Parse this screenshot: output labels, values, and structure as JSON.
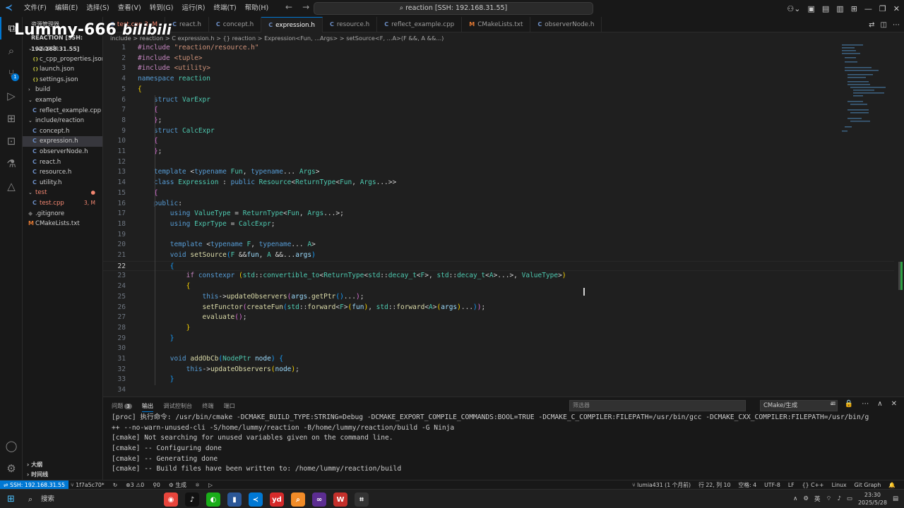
{
  "menu": [
    "文件(F)",
    "编辑(E)",
    "选择(S)",
    "查看(V)",
    "转到(G)",
    "运行(R)",
    "终端(T)",
    "帮助(H)"
  ],
  "command_center": "reaction [SSH: 192.168.31.55]",
  "watermark": {
    "name": "Lummy-666",
    "site": "bilibili"
  },
  "sidebar": {
    "title": "资源管理器",
    "root": "REACTION [SSH: 192.168.31.55]",
    "items": [
      {
        "label": ".vscode",
        "kind": "folder-open",
        "depth": 1
      },
      {
        "label": "c_cpp_properties.json",
        "kind": "json",
        "depth": 2
      },
      {
        "label": "launch.json",
        "kind": "json",
        "depth": 2
      },
      {
        "label": "settings.json",
        "kind": "json",
        "depth": 2
      },
      {
        "label": "build",
        "kind": "folder",
        "depth": 1
      },
      {
        "label": "example",
        "kind": "folder-open",
        "depth": 1
      },
      {
        "label": "reflect_example.cpp",
        "kind": "cpp",
        "depth": 2
      },
      {
        "label": "include/reaction",
        "kind": "folder-open",
        "depth": 1
      },
      {
        "label": "concept.h",
        "kind": "cpp",
        "depth": 2
      },
      {
        "label": "expression.h",
        "kind": "cpp",
        "depth": 2,
        "selected": true
      },
      {
        "label": "observerNode.h",
        "kind": "cpp",
        "depth": 2
      },
      {
        "label": "react.h",
        "kind": "cpp",
        "depth": 2
      },
      {
        "label": "resource.h",
        "kind": "cpp",
        "depth": 2
      },
      {
        "label": "utility.h",
        "kind": "cpp",
        "depth": 2
      },
      {
        "label": "test",
        "kind": "folder-open",
        "depth": 1,
        "error": true,
        "tag": "●"
      },
      {
        "label": "test.cpp",
        "kind": "cpp",
        "depth": 2,
        "error": true,
        "tag": "3, M"
      },
      {
        "label": ".gitignore",
        "kind": "git",
        "depth": 1
      },
      {
        "label": "CMakeLists.txt",
        "kind": "cmake",
        "depth": 1
      }
    ],
    "outline": "大纲",
    "timeline": "时间线"
  },
  "tabs": [
    {
      "label": "test.cpp 3, M",
      "err": true
    },
    {
      "label": "react.h"
    },
    {
      "label": "concept.h"
    },
    {
      "label": "expression.h",
      "active": true
    },
    {
      "label": "resource.h"
    },
    {
      "label": "reflect_example.cpp"
    },
    {
      "label": "CMakeLists.txt",
      "cmake": true
    },
    {
      "label": "observerNode.h"
    }
  ],
  "breadcrumb": "include > reaction > C expression.h > {} reaction > Expression<Fun, ...Args> > setSource<F, ...A>(F &&, A &&...)",
  "code": [
    {
      "n": 1,
      "t": [
        [
          "pp",
          "#include "
        ],
        [
          "str",
          "\"reaction/resource.h\""
        ]
      ]
    },
    {
      "n": 2,
      "t": [
        [
          "pp",
          "#include "
        ],
        [
          "str",
          "<tuple>"
        ]
      ]
    },
    {
      "n": 3,
      "t": [
        [
          "pp",
          "#include "
        ],
        [
          "str",
          "<utility>"
        ]
      ]
    },
    {
      "n": 4,
      "t": [
        [
          "kw",
          "namespace "
        ],
        [
          "ty",
          "reaction"
        ]
      ]
    },
    {
      "n": 5,
      "t": [
        [
          "br1",
          "{"
        ]
      ]
    },
    {
      "n": 6,
      "t": [
        [
          "op",
          "    "
        ],
        [
          "kw",
          "struct "
        ],
        [
          "ty",
          "VarExpr"
        ]
      ]
    },
    {
      "n": 7,
      "t": [
        [
          "op",
          "    "
        ],
        [
          "br2",
          "{"
        ]
      ]
    },
    {
      "n": 8,
      "t": [
        [
          "op",
          "    "
        ],
        [
          "br2",
          "}"
        ],
        [
          "op",
          ";"
        ]
      ]
    },
    {
      "n": 9,
      "t": [
        [
          "op",
          "    "
        ],
        [
          "kw",
          "struct "
        ],
        [
          "ty",
          "CalcExpr"
        ]
      ]
    },
    {
      "n": 10,
      "t": [
        [
          "op",
          "    "
        ],
        [
          "br2",
          "{"
        ]
      ]
    },
    {
      "n": 11,
      "t": [
        [
          "op",
          "    "
        ],
        [
          "br2",
          "}"
        ],
        [
          "op",
          ";"
        ]
      ]
    },
    {
      "n": 12,
      "t": []
    },
    {
      "n": 13,
      "t": [
        [
          "op",
          "    "
        ],
        [
          "kw",
          "template "
        ],
        [
          "op",
          "<"
        ],
        [
          "kw",
          "typename "
        ],
        [
          "ty",
          "Fun"
        ],
        [
          "op",
          ", "
        ],
        [
          "kw",
          "typename"
        ],
        [
          "op",
          "... "
        ],
        [
          "ty",
          "Args"
        ],
        [
          "op",
          ">"
        ]
      ]
    },
    {
      "n": 14,
      "t": [
        [
          "op",
          "    "
        ],
        [
          "kw",
          "class "
        ],
        [
          "ty",
          "Expression"
        ],
        [
          "op",
          " : "
        ],
        [
          "kw",
          "public "
        ],
        [
          "ty",
          "Resource"
        ],
        [
          "op",
          "<"
        ],
        [
          "ty",
          "ReturnType"
        ],
        [
          "op",
          "<"
        ],
        [
          "ty",
          "Fun"
        ],
        [
          "op",
          ", "
        ],
        [
          "ty",
          "Args"
        ],
        [
          "op",
          "...>>"
        ]
      ]
    },
    {
      "n": 15,
      "t": [
        [
          "op",
          "    "
        ],
        [
          "br2",
          "{"
        ]
      ]
    },
    {
      "n": 16,
      "t": [
        [
          "op",
          "    "
        ],
        [
          "kw",
          "public"
        ],
        [
          "op",
          ":"
        ]
      ]
    },
    {
      "n": 17,
      "t": [
        [
          "op",
          "        "
        ],
        [
          "kw",
          "using "
        ],
        [
          "ty",
          "ValueType"
        ],
        [
          "op",
          " = "
        ],
        [
          "ty",
          "ReturnType"
        ],
        [
          "op",
          "<"
        ],
        [
          "ty",
          "Fun"
        ],
        [
          "op",
          ", "
        ],
        [
          "ty",
          "Args"
        ],
        [
          "op",
          "...>;"
        ]
      ]
    },
    {
      "n": 18,
      "t": [
        [
          "op",
          "        "
        ],
        [
          "kw",
          "using "
        ],
        [
          "ty",
          "ExprType"
        ],
        [
          "op",
          " = "
        ],
        [
          "ty",
          "CalcExpr"
        ],
        [
          "op",
          ";"
        ]
      ]
    },
    {
      "n": 19,
      "t": []
    },
    {
      "n": 20,
      "t": [
        [
          "op",
          "        "
        ],
        [
          "kw",
          "template "
        ],
        [
          "op",
          "<"
        ],
        [
          "kw",
          "typename "
        ],
        [
          "ty",
          "F"
        ],
        [
          "op",
          ", "
        ],
        [
          "kw",
          "typename"
        ],
        [
          "op",
          "... "
        ],
        [
          "ty",
          "A"
        ],
        [
          "op",
          ">"
        ]
      ]
    },
    {
      "n": 21,
      "t": [
        [
          "op",
          "        "
        ],
        [
          "kw",
          "void "
        ],
        [
          "fn",
          "setSource"
        ],
        [
          "br3",
          "("
        ],
        [
          "ty",
          "F"
        ],
        [
          "op",
          " &&"
        ],
        [
          "id",
          "fun"
        ],
        [
          "op",
          ", "
        ],
        [
          "ty",
          "A"
        ],
        [
          "op",
          " &&..."
        ],
        [
          "id",
          "args"
        ],
        [
          "br3",
          ")"
        ]
      ]
    },
    {
      "n": 22,
      "t": [
        [
          "op",
          "        "
        ],
        [
          "br3",
          "{"
        ]
      ],
      "cur": true
    },
    {
      "n": 23,
      "t": [
        [
          "op",
          "            "
        ],
        [
          "ctl",
          "if "
        ],
        [
          "kw",
          "constexpr "
        ],
        [
          "br1",
          "("
        ],
        [
          "ty",
          "std"
        ],
        [
          "op",
          "::"
        ],
        [
          "ty",
          "convertible_to"
        ],
        [
          "op",
          "<"
        ],
        [
          "ty",
          "ReturnType"
        ],
        [
          "op",
          "<"
        ],
        [
          "ty",
          "std"
        ],
        [
          "op",
          "::"
        ],
        [
          "ty",
          "decay_t"
        ],
        [
          "op",
          "<"
        ],
        [
          "ty",
          "F"
        ],
        [
          "op",
          ">, "
        ],
        [
          "ty",
          "std"
        ],
        [
          "op",
          "::"
        ],
        [
          "ty",
          "decay_t"
        ],
        [
          "op",
          "<"
        ],
        [
          "ty",
          "A"
        ],
        [
          "op",
          ">...>, "
        ],
        [
          "ty",
          "ValueType"
        ],
        [
          "op",
          ">"
        ],
        [
          "br1",
          ")"
        ]
      ]
    },
    {
      "n": 24,
      "t": [
        [
          "op",
          "            "
        ],
        [
          "br1",
          "{"
        ]
      ]
    },
    {
      "n": 25,
      "t": [
        [
          "op",
          "                "
        ],
        [
          "kw",
          "this"
        ],
        [
          "op",
          "->"
        ],
        [
          "fn",
          "updateObservers"
        ],
        [
          "br2",
          "("
        ],
        [
          "id",
          "args"
        ],
        [
          "op",
          "."
        ],
        [
          "fn",
          "getPtr"
        ],
        [
          "br3",
          "()"
        ],
        [
          "op",
          "..."
        ],
        [
          "br2",
          ")"
        ],
        [
          "op",
          ";"
        ]
      ]
    },
    {
      "n": 26,
      "t": [
        [
          "op",
          "                "
        ],
        [
          "fn",
          "setFunctor"
        ],
        [
          "br2",
          "("
        ],
        [
          "fn",
          "createFun"
        ],
        [
          "br3",
          "("
        ],
        [
          "ty",
          "std"
        ],
        [
          "op",
          "::"
        ],
        [
          "fn",
          "forward"
        ],
        [
          "op",
          "<"
        ],
        [
          "ty",
          "F"
        ],
        [
          "op",
          ">"
        ],
        [
          "br1",
          "("
        ],
        [
          "id",
          "fun"
        ],
        [
          "br1",
          ")"
        ],
        [
          "op",
          ", "
        ],
        [
          "ty",
          "std"
        ],
        [
          "op",
          "::"
        ],
        [
          "fn",
          "forward"
        ],
        [
          "op",
          "<"
        ],
        [
          "ty",
          "A"
        ],
        [
          "op",
          ">"
        ],
        [
          "br1",
          "("
        ],
        [
          "id",
          "args"
        ],
        [
          "br1",
          ")"
        ],
        [
          "op",
          "..."
        ],
        [
          "br3",
          ")"
        ],
        [
          "br2",
          ")"
        ],
        [
          "op",
          ";"
        ]
      ]
    },
    {
      "n": 27,
      "t": [
        [
          "op",
          "                "
        ],
        [
          "fn",
          "evaluate"
        ],
        [
          "br2",
          "()"
        ],
        [
          "op",
          ";"
        ]
      ]
    },
    {
      "n": 28,
      "t": [
        [
          "op",
          "            "
        ],
        [
          "br1",
          "}"
        ]
      ]
    },
    {
      "n": 29,
      "t": [
        [
          "op",
          "        "
        ],
        [
          "br3",
          "}"
        ]
      ]
    },
    {
      "n": 30,
      "t": []
    },
    {
      "n": 31,
      "t": [
        [
          "op",
          "        "
        ],
        [
          "kw",
          "void "
        ],
        [
          "fn",
          "addObCb"
        ],
        [
          "br3",
          "("
        ],
        [
          "ty",
          "NodePtr"
        ],
        [
          "op",
          " "
        ],
        [
          "id",
          "node"
        ],
        [
          "br3",
          ")"
        ],
        [
          "op",
          " "
        ],
        [
          "br3",
          "{"
        ]
      ]
    },
    {
      "n": 32,
      "t": [
        [
          "op",
          "            "
        ],
        [
          "kw",
          "this"
        ],
        [
          "op",
          "->"
        ],
        [
          "fn",
          "updateObservers"
        ],
        [
          "br1",
          "("
        ],
        [
          "id",
          "node"
        ],
        [
          "br1",
          ")"
        ],
        [
          "op",
          ";"
        ]
      ]
    },
    {
      "n": 33,
      "t": [
        [
          "op",
          "        "
        ],
        [
          "br3",
          "}"
        ]
      ]
    },
    {
      "n": 34,
      "t": []
    }
  ],
  "panel": {
    "tabs": [
      "问题",
      "输出",
      "调试控制台",
      "终端",
      "端口"
    ],
    "problems_count": "3",
    "active": "输出",
    "filter_placeholder": "筛选器",
    "channel": "CMake/生成",
    "lines": [
      "[proc] 执行命令: /usr/bin/cmake -DCMAKE_BUILD_TYPE:STRING=Debug -DCMAKE_EXPORT_COMPILE_COMMANDS:BOOL=TRUE -DCMAKE_C_COMPILER:FILEPATH=/usr/bin/gcc -DCMAKE_CXX_COMPILER:FILEPATH=/usr/bin/g",
      "++ --no-warn-unused-cli -S/home/lummy/reaction -B/home/lummy/reaction/build -G Ninja",
      "[cmake] Not searching for unused variables given on the command line.",
      "[cmake] -- Configuring done",
      "[cmake] -- Generating done",
      "[cmake] -- Build files have been written to: /home/lummy/reaction/build"
    ]
  },
  "status": {
    "remote": "SSH: 192.168.31.55",
    "branch": "1f7a5c70*",
    "errors": "3",
    "warnings": "0",
    "ports": "0",
    "build": "生成",
    "author": "lumia431 (1 个月前)",
    "position": "行 22, 列 10",
    "spaces": "空格: 4",
    "encoding": "UTF-8",
    "eol": "LF",
    "lang": "C++",
    "os": "Linux",
    "graph": "Git Graph"
  },
  "taskbar": {
    "search": "搜索",
    "time": "23:30",
    "date": "2025/5/28",
    "ime": "英"
  }
}
